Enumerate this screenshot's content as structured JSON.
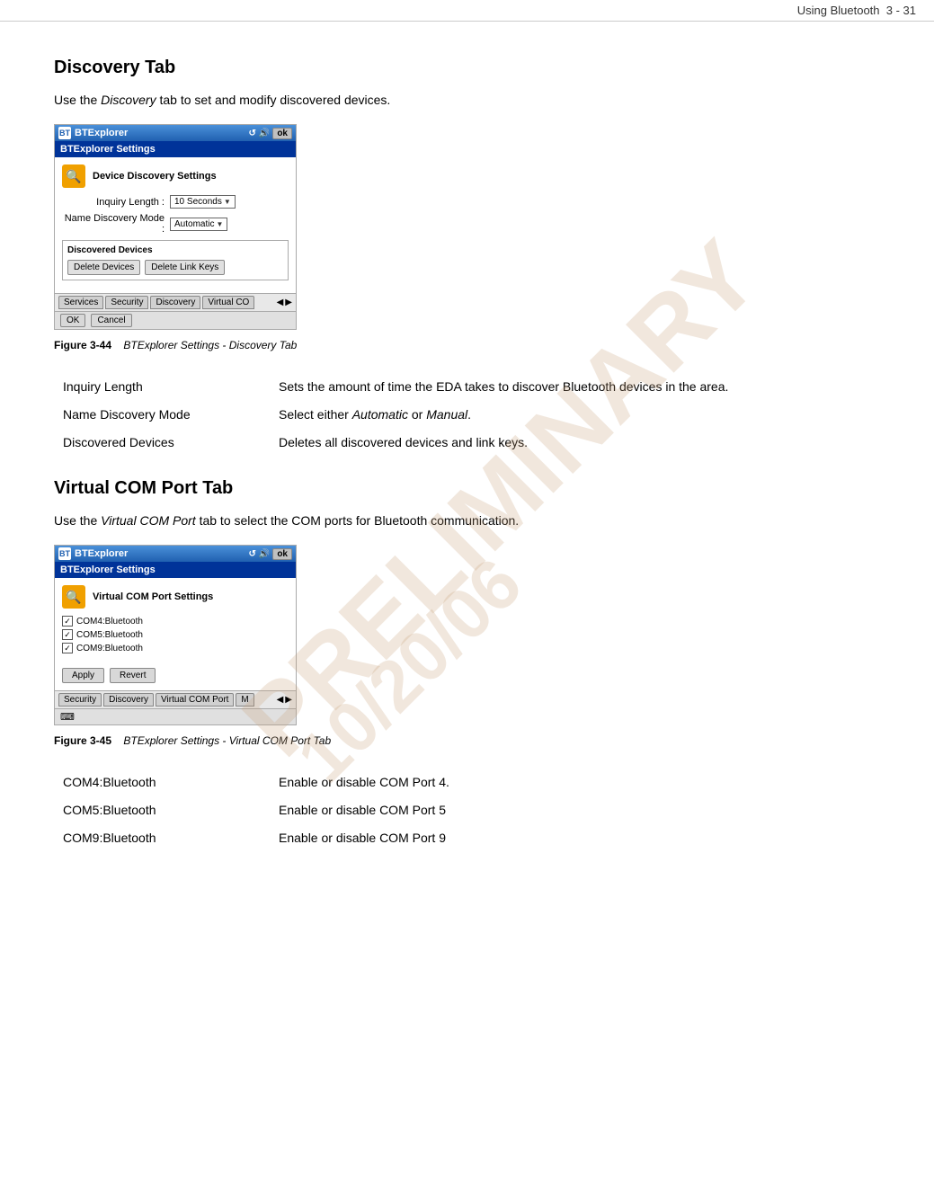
{
  "header": {
    "title": "Using Bluetooth",
    "page_ref": "3 - 31"
  },
  "discovery_tab": {
    "heading": "Discovery Tab",
    "intro": "Use the Discovery tab to set and modify discovered devices.",
    "screenshot": {
      "titlebar": "BTExplorer",
      "titlebar_icon": "BT",
      "subheader": "BTExplorer Settings",
      "section_title": "Device Discovery Settings",
      "inquiry_label": "Inquiry Length :",
      "inquiry_value": "10 Seconds",
      "discovery_label": "Name Discovery Mode :",
      "discovery_value": "Automatic",
      "discovered_group": "Discovered Devices",
      "delete_devices_btn": "Delete Devices",
      "delete_link_btn": "Delete Link Keys",
      "tabs": [
        "Services",
        "Security",
        "Discovery",
        "Virtual CO"
      ],
      "ok_btn": "OK",
      "cancel_btn": "Cancel"
    },
    "figure_num": "Figure 3-44",
    "figure_caption": "BTExplorer Settings - Discovery Tab",
    "fields": [
      {
        "label": "Inquiry Length",
        "description": "Sets the amount of time the EDA takes to discover Bluetooth devices in the area."
      },
      {
        "label": "Name Discovery Mode",
        "description": "Select either Automatic or Manual."
      },
      {
        "label": "Discovered Devices",
        "description": "Deletes all discovered devices and link keys."
      }
    ]
  },
  "virtual_com_tab": {
    "heading": "Virtual COM Port Tab",
    "intro": "Use the Virtual COM Port tab to select the COM ports for Bluetooth communication.",
    "screenshot": {
      "titlebar": "BTExplorer",
      "subheader": "BTExplorer Settings",
      "section_title": "Virtual COM Port Settings",
      "checkboxes": [
        "COM4:Bluetooth",
        "COM5:Bluetooth",
        "COM9:Bluetooth"
      ],
      "apply_btn": "Apply",
      "revert_btn": "Revert",
      "tabs": [
        "Security",
        "Discovery",
        "Virtual COM Port",
        "M"
      ]
    },
    "figure_num": "Figure 3-45",
    "figure_caption": "BTExplorer Settings - Virtual COM Port Tab",
    "fields": [
      {
        "label": "COM4:Bluetooth",
        "description": "Enable or disable COM Port 4."
      },
      {
        "label": "COM5:Bluetooth",
        "description": "Enable or disable COM Port 5"
      },
      {
        "label": "COM9:Bluetooth",
        "description": "Enable or disable COM Port 9"
      }
    ]
  },
  "watermark": {
    "line1": "PRELIMINARY",
    "line2": "10/20/06"
  }
}
